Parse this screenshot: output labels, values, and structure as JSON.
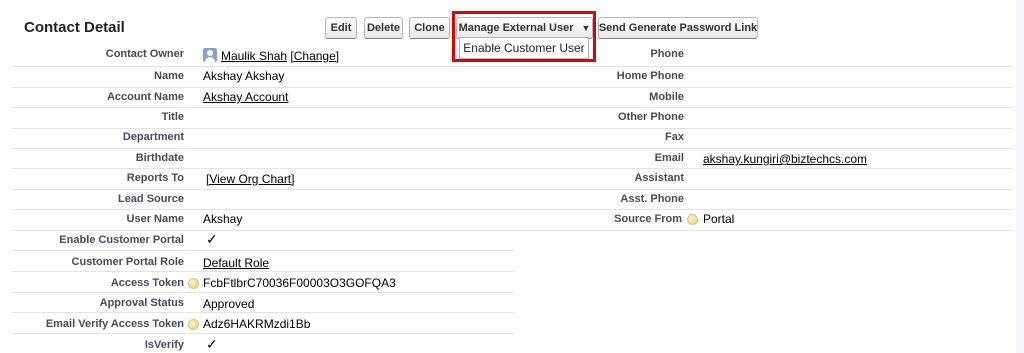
{
  "section_title": "Contact Detail",
  "buttons": {
    "edit": "Edit",
    "delete": "Delete",
    "clone": "Clone",
    "manage_external_user": "Manage External User",
    "send_password_link": "Send Generate Password Link"
  },
  "dropdown": {
    "enable_customer_user": "Enable Customer User"
  },
  "left_fields": {
    "contact_owner": {
      "label": "Contact Owner",
      "value": "Maulik Shah",
      "change": "[Change]"
    },
    "name": {
      "label": "Name",
      "value": "Akshay Akshay"
    },
    "account_name": {
      "label": "Account Name",
      "value": "Akshay Account"
    },
    "title": {
      "label": "Title",
      "value": ""
    },
    "department": {
      "label": "Department",
      "value": ""
    },
    "birthdate": {
      "label": "Birthdate",
      "value": ""
    },
    "reports_to": {
      "label": "Reports To",
      "value": "[View Org Chart]"
    },
    "lead_source": {
      "label": "Lead Source",
      "value": ""
    },
    "user_name": {
      "label": "User Name",
      "value": "Akshay"
    },
    "enable_customer_portal": {
      "label": "Enable Customer Portal",
      "checked": true
    },
    "customer_portal_role": {
      "label": "Customer Portal Role",
      "value": "Default Role"
    },
    "access_token": {
      "label": "Access Token",
      "value": "FcbFtlbrC70036F00003O3GOFQA3"
    },
    "approval_status": {
      "label": "Approval Status",
      "value": "Approved"
    },
    "email_verify_access_token": {
      "label": "Email Verify Access Token",
      "value": "Adz6HAKRMzdi1Bb"
    },
    "is_verify": {
      "label": "IsVerify",
      "checked": true
    }
  },
  "right_fields": {
    "phone": {
      "label": "Phone",
      "value": ""
    },
    "home_phone": {
      "label": "Home Phone",
      "value": ""
    },
    "mobile": {
      "label": "Mobile",
      "value": ""
    },
    "other_phone": {
      "label": "Other Phone",
      "value": ""
    },
    "fax": {
      "label": "Fax",
      "value": ""
    },
    "email": {
      "label": "Email",
      "value": "akshay.kungiri@biztechcs.com"
    },
    "assistant": {
      "label": "Assistant",
      "value": ""
    },
    "asst_phone": {
      "label": "Asst. Phone",
      "value": ""
    },
    "source_from": {
      "label": "Source From",
      "value": "Portal"
    }
  },
  "checkmark_glyph": "✓",
  "colors": {
    "highlight": "#e00000",
    "label": "#4a4a56",
    "divider": "#e3e3e3"
  }
}
